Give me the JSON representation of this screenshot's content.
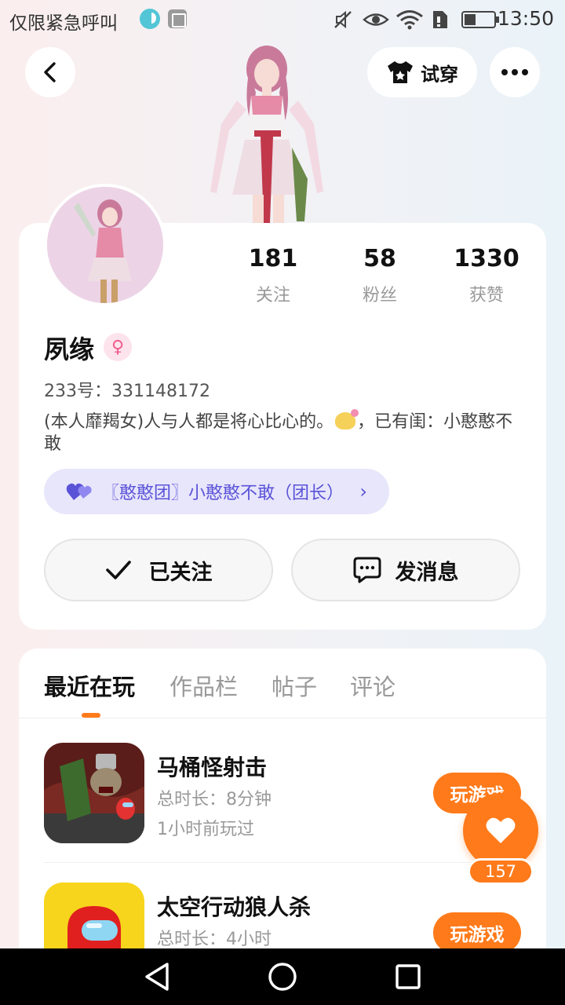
{
  "status_bar": {
    "carrier": "仅限紧急呼叫",
    "time": "13:50"
  },
  "header": {
    "try_on_label": "试穿"
  },
  "profile": {
    "name": "夙缘",
    "id_text": "233号：331148172",
    "bio": "(本人靡羯女)人与人都是将心比心的。",
    "bio_tail": "，已有闺：小憨憨不敢",
    "group_chip": "〖憨憨团〗小憨憨不敢（团长）",
    "stats": [
      {
        "value": "181",
        "label": "关注"
      },
      {
        "value": "58",
        "label": "粉丝"
      },
      {
        "value": "1330",
        "label": "获赞"
      }
    ],
    "follow_label": "已关注",
    "message_label": "发消息"
  },
  "tabs": [
    "最近在玩",
    "作品栏",
    "帖子",
    "评论"
  ],
  "games": [
    {
      "name": "马桶怪射击",
      "duration": "总时长：8分钟",
      "last_played": "1小时前玩过",
      "play_label": "玩游戏"
    },
    {
      "name": "太空行动狼人杀",
      "duration": "总时长：4小时",
      "play_label": "玩游戏"
    }
  ],
  "like_count": "157",
  "colors": {
    "accent": "#ff7a1a",
    "group_chip_bg": "#e8e6fb",
    "group_chip_text": "#5a53d8"
  }
}
